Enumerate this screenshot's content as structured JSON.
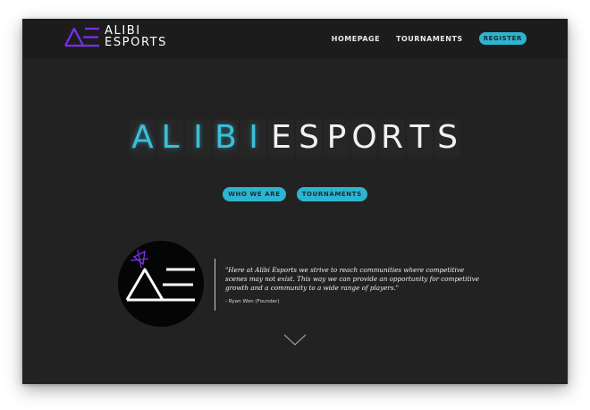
{
  "brand": {
    "logo_line1": "ALIBI",
    "logo_line2": "ESPORTS",
    "accent_color": "#2cb4d0",
    "logo_purple": "#7b2ff2"
  },
  "nav": {
    "homepage": "HOMEPAGE",
    "tournaments": "TOURNAMENTS",
    "register": "REGISTER"
  },
  "hero": {
    "letters": [
      "A",
      "L",
      "I",
      "B",
      "I",
      "E",
      "S",
      "P",
      "O",
      "R",
      "T",
      "S"
    ]
  },
  "buttons": {
    "who_we_are": "WHO WE ARE",
    "tournaments": "TOURNAMENTS"
  },
  "quote": {
    "text": "\"Here at Alibi Esports we strive to reach communities where competitive scenes may not exist. This way we can provide an opportunity for competitive growth and a community to a wide range of players.\"",
    "author": "- Ryan Won (Founder)"
  },
  "icons": {
    "scroll": "chevron-down-icon",
    "logo": "alibi-logo-icon"
  }
}
